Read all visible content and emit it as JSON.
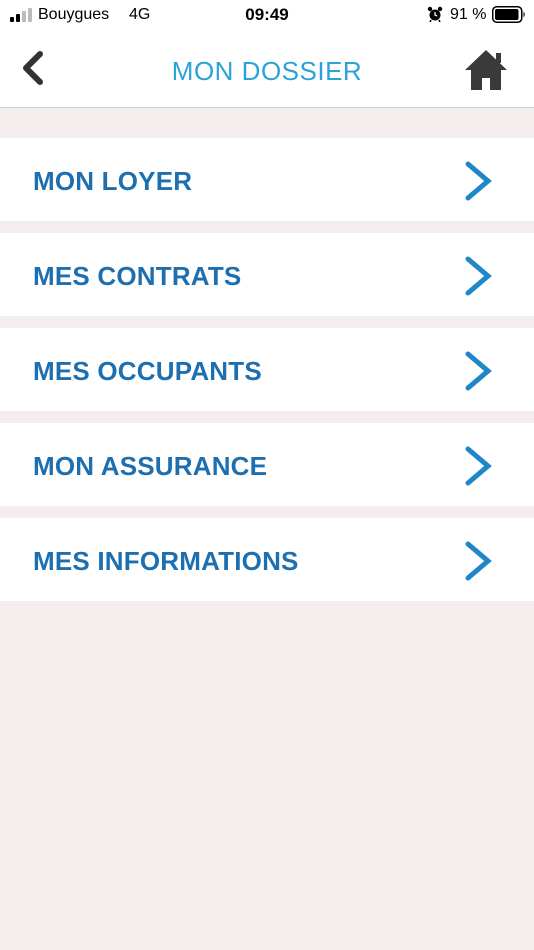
{
  "status_bar": {
    "carrier": "Bouygues",
    "network": "4G",
    "time": "09:49",
    "battery_percent": "91 %",
    "icons": [
      "signal-icon",
      "alarm-icon",
      "battery-icon"
    ]
  },
  "nav": {
    "title": "MON DOSSIER",
    "back_icon": "chevron-left-icon",
    "home_icon": "home-icon"
  },
  "menu": {
    "items": [
      {
        "label": "MON LOYER"
      },
      {
        "label": "MES CONTRATS"
      },
      {
        "label": "MES OCCUPANTS"
      },
      {
        "label": "MON ASSURANCE"
      },
      {
        "label": "MES INFORMATIONS"
      }
    ]
  },
  "colors": {
    "title": "#2aa3d8",
    "item_label": "#1d6fb0",
    "chevron": "#1f86c8",
    "background": "#f5eeee"
  }
}
